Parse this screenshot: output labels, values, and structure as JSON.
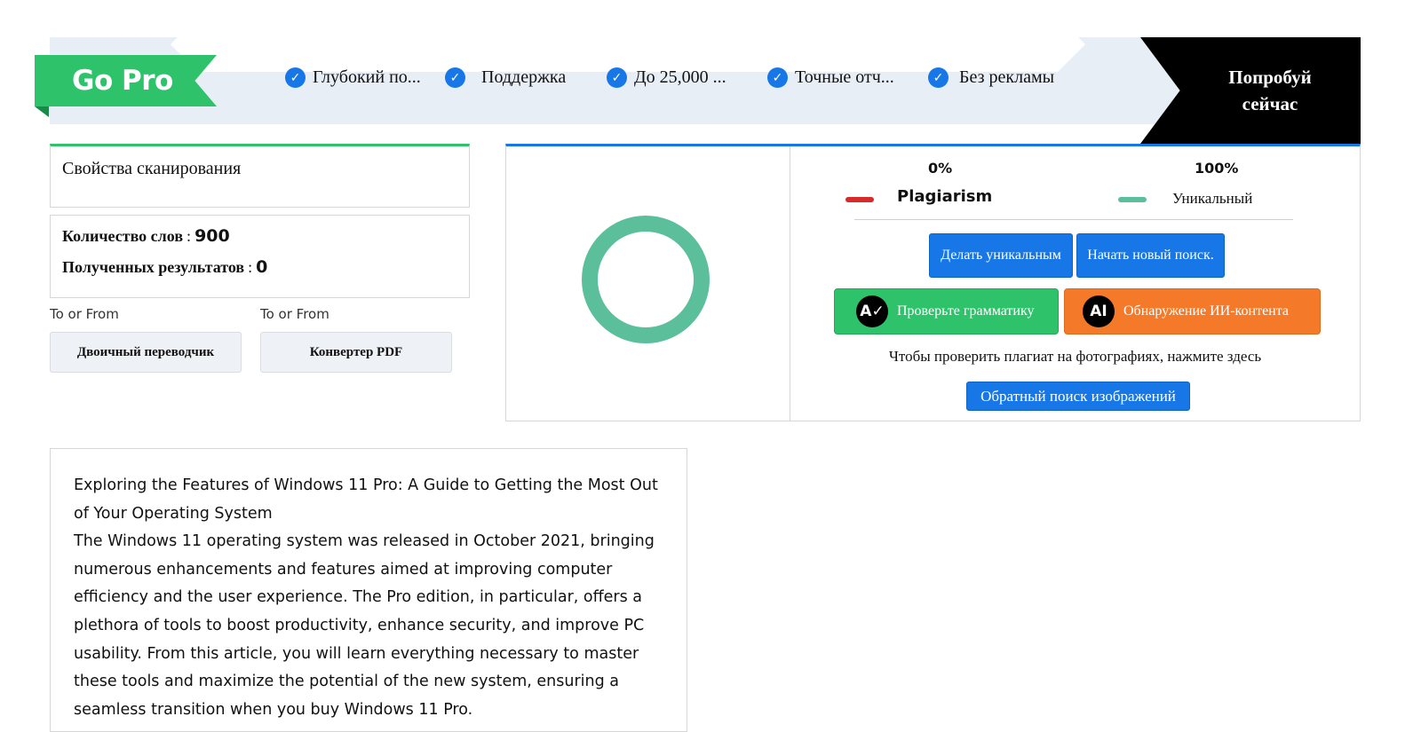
{
  "banner": {
    "go_pro": "Go Pro",
    "features": [
      "Глубокий по...",
      "Поддержка",
      "До 25,000 ...",
      "Точные отч...",
      "Без рекламы"
    ],
    "cta_line1": "Попробуй",
    "cta_line2": "сейчас"
  },
  "scan": {
    "title": "Свойства сканирования",
    "word_count_label": "Количество слов",
    "word_count": "900",
    "results_label": "Полученных результатов",
    "results": "0"
  },
  "tools": {
    "to_or_from": "To or From",
    "binary_translator": "Двоичный переводчик",
    "pdf_converter": "Конвертер PDF"
  },
  "results_panel": {
    "plagiarism_percent": "0%",
    "unique_percent": "100%",
    "plagiarism_label": "Plagiarism",
    "unique_label": "Уникальный",
    "plagiarism_value": 0,
    "unique_value": 100,
    "make_unique": "Делать уникальным",
    "new_search": "Начать новый поиск.",
    "grammar": "Проверьте грамматику",
    "ai_detect": "Обнаружение ИИ-контента",
    "photo_text": "Чтобы проверить плагиат на фотографиях, нажмите здесь",
    "reverse_search": "Обратный поиск изображений"
  },
  "article": {
    "title": "Exploring the Features of Windows 11 Pro: A Guide to Getting the Most Out of Your Operating System",
    "body": "The Windows 11 operating system was released in October 2021, bringing numerous enhancements and features aimed at improving computer efficiency and the user experience. The Pro edition, in particular, offers a plethora of tools to boost productivity, enhance security, and improve PC usability. From this article, you will learn everything necessary to master these tools and maximize the potential of the new system, ensuring a seamless transition when you buy Windows 11 Pro."
  },
  "colors": {
    "green": "#2ec26b",
    "blue": "#1877e6",
    "orange": "#f47a2a",
    "unique_teal": "#5bbf9b",
    "plagiarism_red": "#d62b2b"
  },
  "icons": {
    "check": "check-circle-icon",
    "grammar": "grammar-a-icon",
    "ai": "ai-sparkle-icon"
  }
}
